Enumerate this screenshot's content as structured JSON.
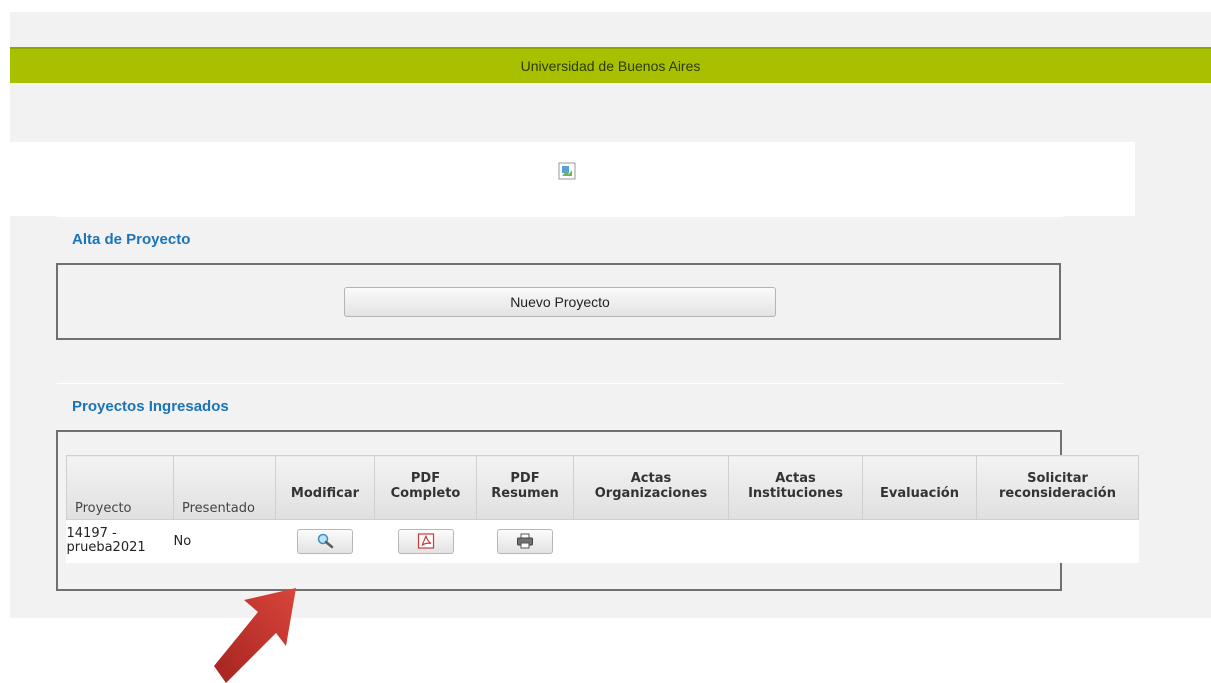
{
  "header": {
    "title": "Universidad de Buenos Aires"
  },
  "alta": {
    "title": "Alta de Proyecto",
    "nuevo_button": "Nuevo Proyecto"
  },
  "ingresados": {
    "title": "Proyectos Ingresados",
    "columns": [
      "Proyecto",
      "Presentado",
      "Modificar",
      "PDF\nCompleto",
      "PDF\nResumen",
      "Actas\nOrganizaciones",
      "Actas\nInstituciones",
      "Evaluación",
      "Solicitar\nreconsideración"
    ],
    "rows": [
      {
        "proyecto": "14197 -\nprueba2021",
        "presentado": "No"
      }
    ]
  },
  "icons": {
    "modificar": "magnifier-icon",
    "pdf": "pdf-icon",
    "resumen": "printer-icon",
    "banner": "broken-image-icon"
  },
  "colors": {
    "topbar": "#a9c001",
    "section_title": "#1b74b8",
    "arrow": "#c0302a"
  }
}
